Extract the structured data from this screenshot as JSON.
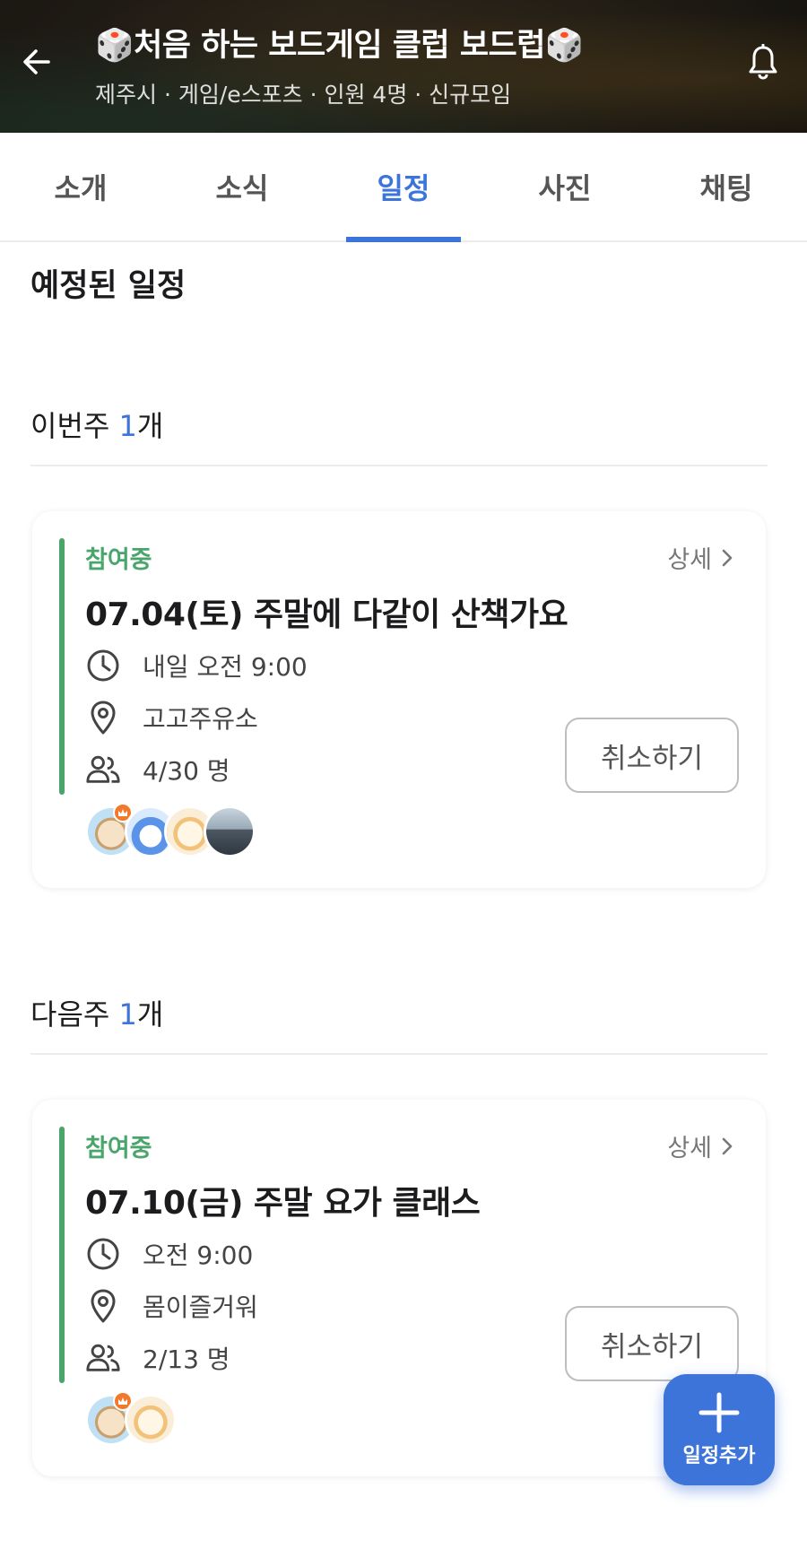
{
  "header": {
    "title": "🎲처음 하는 보드게임 클럽 보드럽🎲",
    "subtitle": "제주시 · 게임/e스포츠 · 인원 4명 · 신규모임"
  },
  "tabs": [
    {
      "label": "소개"
    },
    {
      "label": "소식"
    },
    {
      "label": "일정"
    },
    {
      "label": "사진"
    },
    {
      "label": "채팅"
    }
  ],
  "active_tab": "일정",
  "section_title": "예정된 일정",
  "weeks": [
    {
      "label": "이번주",
      "count": "1",
      "count_suffix": "개",
      "event": {
        "status": "참여중",
        "detail_label": "상세",
        "title": "07.04(토)  주말에 다같이 산책가요",
        "time": "내일 오전 9:00",
        "place": "고고주유소",
        "members": "4/30 명",
        "cancel_label": "취소하기"
      }
    },
    {
      "label": "다음주",
      "count": "1",
      "count_suffix": "개",
      "event": {
        "status": "참여중",
        "detail_label": "상세",
        "title": "07.10(금)  주말 요가 클래스",
        "time": "오전 9:00",
        "place": "몸이즐거워",
        "members": "2/13 명",
        "cancel_label": "취소하기"
      }
    }
  ],
  "fab": {
    "label": "일정추가"
  },
  "colors": {
    "accent": "#3d74d9",
    "status_green": "#4aa56c",
    "host_badge": "#f07a2a"
  },
  "icons": [
    "back-arrow-icon",
    "bell-icon",
    "clock-icon",
    "location-pin-icon",
    "people-icon",
    "chevron-right-icon",
    "plus-icon",
    "crown-badge-icon"
  ]
}
